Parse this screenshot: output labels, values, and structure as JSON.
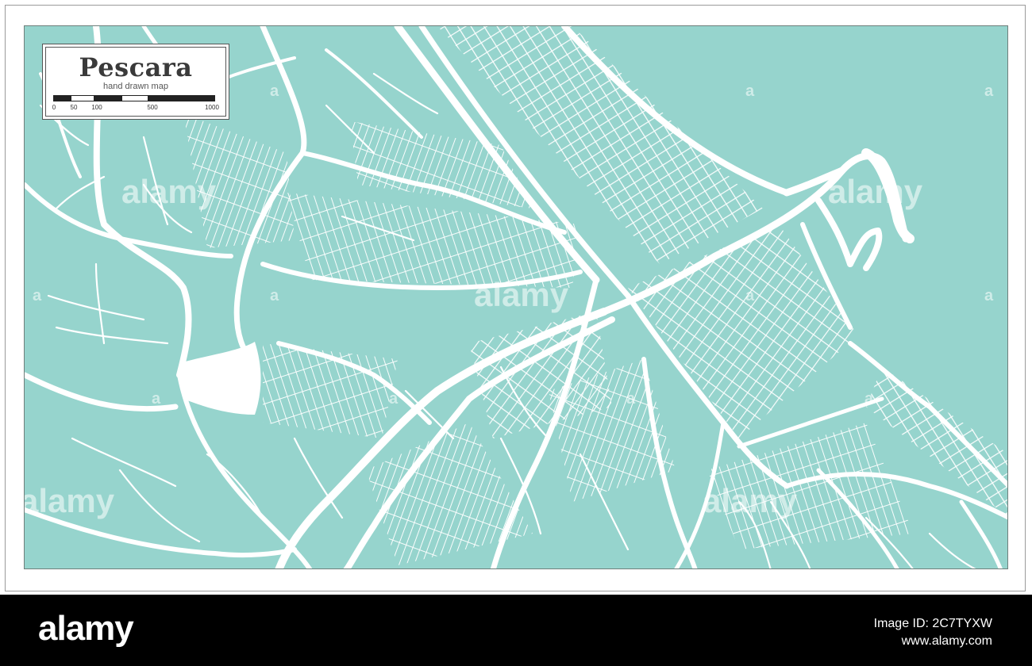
{
  "map": {
    "title": "Pescara",
    "subtitle": "hand drawn map",
    "scale_labels": [
      "0",
      "50",
      "100",
      "500",
      "1000"
    ],
    "colors": {
      "water": "#96d4cd",
      "roads": "#ffffff",
      "frame": "#6f7f7b"
    }
  },
  "watermark": {
    "text": "alamy",
    "letter": "a"
  },
  "footer": {
    "logo": "alamy",
    "image_id": "Image ID: 2C7TYXW",
    "url": "www.alamy.com"
  }
}
